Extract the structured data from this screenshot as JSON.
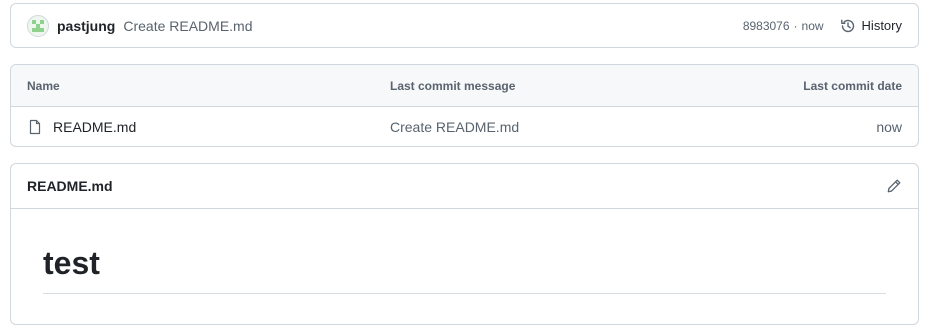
{
  "commit": {
    "author": "pastjung",
    "message": "Create README.md",
    "sha": "8983076",
    "separator": "·",
    "time": "now",
    "history_label": "History"
  },
  "table": {
    "headers": {
      "name": "Name",
      "message": "Last commit message",
      "date": "Last commit date"
    },
    "rows": [
      {
        "name": "README.md",
        "message": "Create README.md",
        "date": "now"
      }
    ]
  },
  "readme": {
    "filename": "README.md",
    "heading": "test"
  },
  "icons": {
    "history": "history-icon",
    "file": "file-icon",
    "edit": "pencil-icon"
  },
  "colors": {
    "border": "#d0d7de",
    "header_bg": "#f6f8fa",
    "muted_text": "#59636e",
    "text": "#1f2328"
  }
}
